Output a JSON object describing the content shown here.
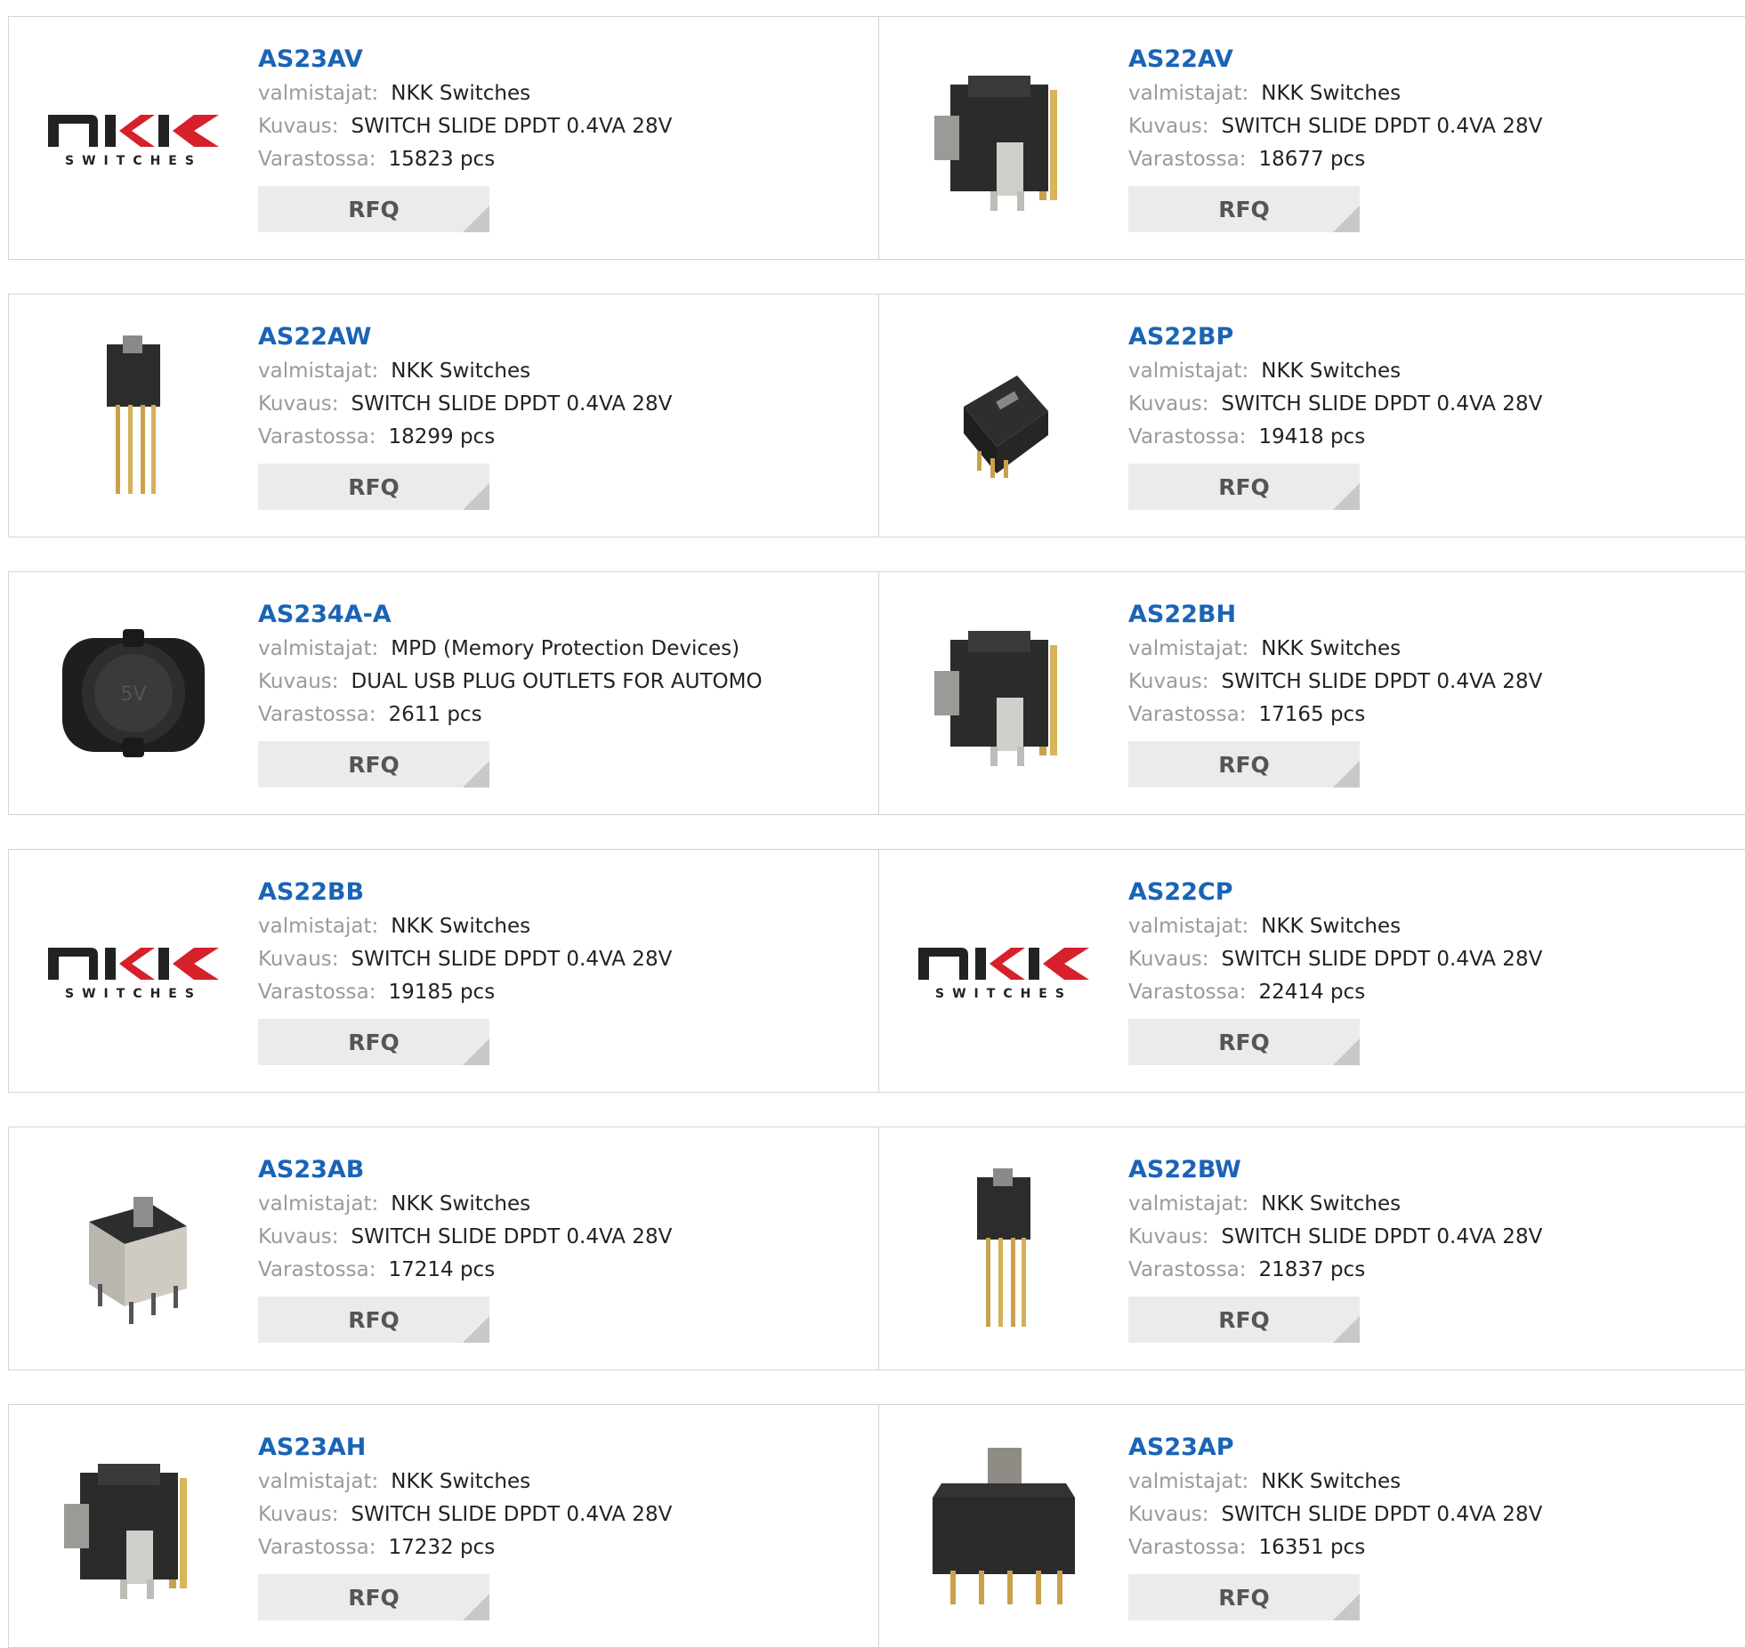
{
  "labels": {
    "manufacturer": "valmistajat:",
    "description": "Kuvaus:",
    "stock": "Varastossa:",
    "rfq": "RFQ"
  },
  "logo": {
    "brand": "NKK",
    "tagline": "SWITCHES"
  },
  "products": [
    {
      "part": "AS23AV",
      "manufacturer": "NKK Switches",
      "description": "SWITCH SLIDE DPDT 0.4VA 28V",
      "stock": "15823 pcs",
      "image": "nkk-logo"
    },
    {
      "part": "AS22AV",
      "manufacturer": "NKK Switches",
      "description": "SWITCH SLIDE DPDT 0.4VA 28V",
      "stock": "18677 pcs",
      "image": "slide-switch-right-angle"
    },
    {
      "part": "AS22AW",
      "manufacturer": "NKK Switches",
      "description": "SWITCH SLIDE DPDT 0.4VA 28V",
      "stock": "18299 pcs",
      "image": "slide-switch-long-pins"
    },
    {
      "part": "AS22BP",
      "manufacturer": "NKK Switches",
      "description": "SWITCH SLIDE DPDT 0.4VA 28V",
      "stock": "19418 pcs",
      "image": "slide-switch-small"
    },
    {
      "part": "AS234A-A",
      "manufacturer": "MPD (Memory Protection Devices)",
      "description": "DUAL USB PLUG OUTLETS FOR AUTOMO",
      "stock": "2611 pcs",
      "image": "usb-outlet"
    },
    {
      "part": "AS22BH",
      "manufacturer": "NKK Switches",
      "description": "SWITCH SLIDE DPDT 0.4VA 28V",
      "stock": "17165 pcs",
      "image": "slide-switch-right-angle"
    },
    {
      "part": "AS22BB",
      "manufacturer": "NKK Switches",
      "description": "SWITCH SLIDE DPDT 0.4VA 28V",
      "stock": "19185 pcs",
      "image": "nkk-logo"
    },
    {
      "part": "AS22CP",
      "manufacturer": "NKK Switches",
      "description": "SWITCH SLIDE DPDT 0.4VA 28V",
      "stock": "22414 pcs",
      "image": "nkk-logo"
    },
    {
      "part": "AS23AB",
      "manufacturer": "NKK Switches",
      "description": "SWITCH SLIDE DPDT 0.4VA 28V",
      "stock": "17214 pcs",
      "image": "slide-switch-metal"
    },
    {
      "part": "AS22BW",
      "manufacturer": "NKK Switches",
      "description": "SWITCH SLIDE DPDT 0.4VA 28V",
      "stock": "21837 pcs",
      "image": "slide-switch-long-pins"
    },
    {
      "part": "AS23AH",
      "manufacturer": "NKK Switches",
      "description": "SWITCH SLIDE DPDT 0.4VA 28V",
      "stock": "17232 pcs",
      "image": "slide-switch-right-angle"
    },
    {
      "part": "AS23AP",
      "manufacturer": "NKK Switches",
      "description": "SWITCH SLIDE DPDT 0.4VA 28V",
      "stock": "16351 pcs",
      "image": "slide-switch-large"
    }
  ]
}
